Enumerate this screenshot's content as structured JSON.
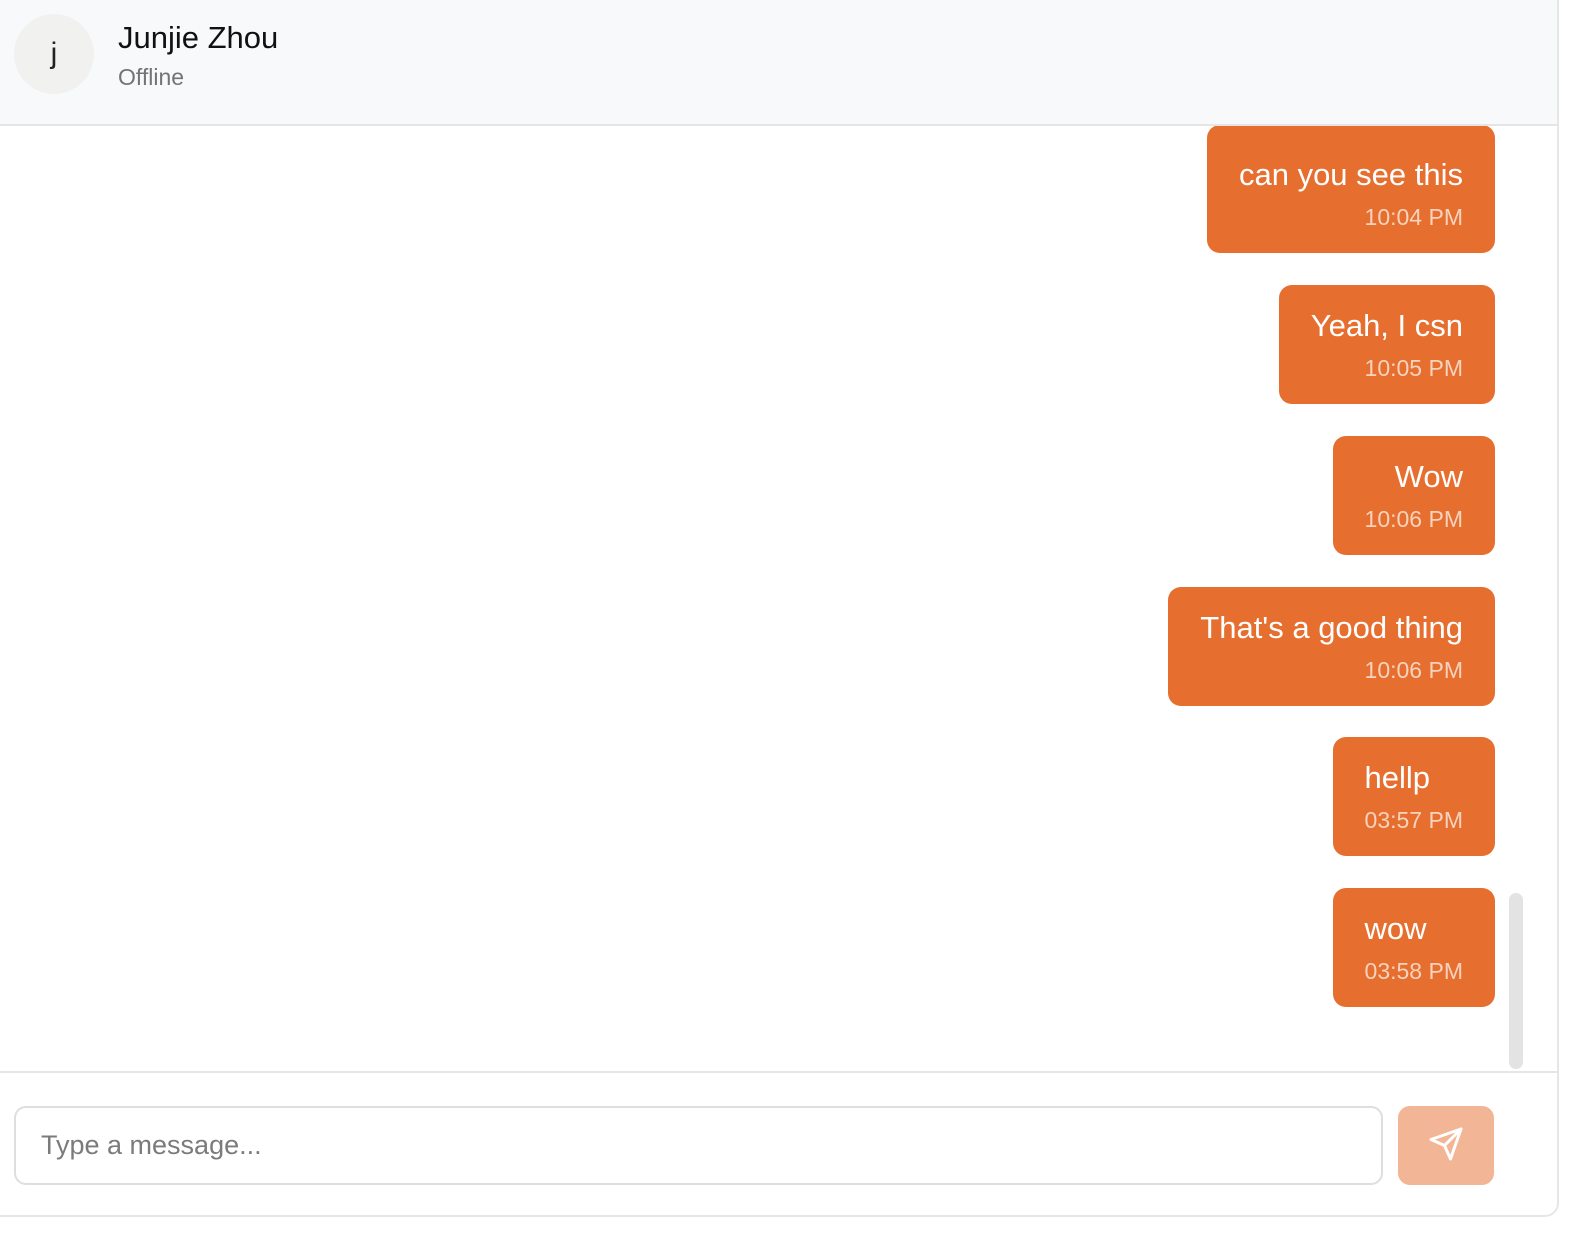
{
  "header": {
    "avatar_initial": "j",
    "name": "Junjie Zhou",
    "status": "Offline"
  },
  "messages": [
    {
      "text": "can you see this",
      "time": "10:04 PM",
      "sender": "me"
    },
    {
      "text": "Yeah, I csn",
      "time": "10:05 PM",
      "sender": "me"
    },
    {
      "text": "Wow",
      "time": "10:06 PM",
      "sender": "me"
    },
    {
      "text": "That's a good thing",
      "time": "10:06 PM",
      "sender": "me"
    },
    {
      "text": "hellp",
      "time": "03:57 PM",
      "sender": "me"
    },
    {
      "text": "wow",
      "time": "03:58 PM",
      "sender": "me"
    }
  ],
  "composer": {
    "placeholder": "Type a message...",
    "value": "",
    "send_icon": "send-icon"
  },
  "colors": {
    "bubble": "#e66f30",
    "send_button_disabled": "#f2b595",
    "header_background": "#f8f9fa"
  }
}
